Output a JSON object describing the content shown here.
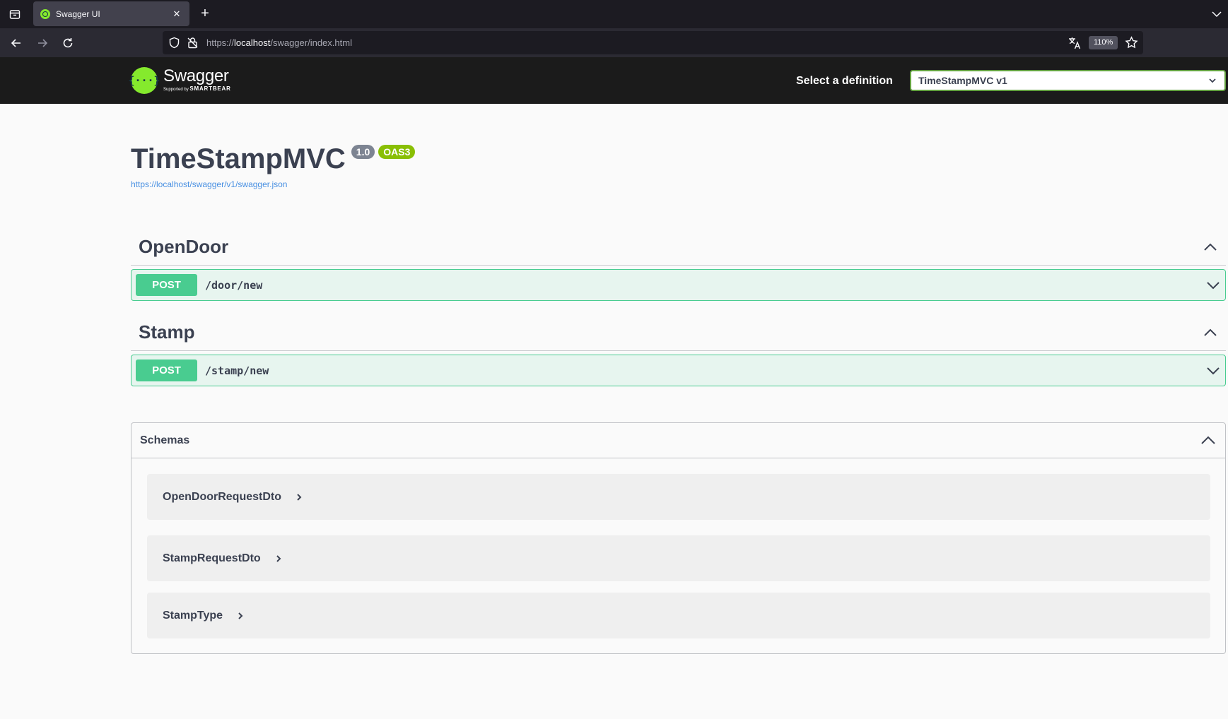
{
  "browser": {
    "tab_title": "Swagger UI",
    "url_prefix": "https://",
    "url_host": "localhost",
    "url_path": "/swagger/index.html",
    "zoom": "110%"
  },
  "swagger": {
    "logo_name": "Swagger",
    "logo_sub_prefix": "Supported by",
    "logo_sub_brand": "SMARTBEAR",
    "definition_label": "Select a definition",
    "definition_value": "TimeStampMVC v1"
  },
  "info": {
    "title": "TimeStampMVC",
    "version": "1.0",
    "oas": "OAS3",
    "spec_url": "https://localhost/swagger/v1/swagger.json"
  },
  "tags": [
    {
      "name": "OpenDoor",
      "operations": [
        {
          "method": "POST",
          "path": "/door/new"
        }
      ]
    },
    {
      "name": "Stamp",
      "operations": [
        {
          "method": "POST",
          "path": "/stamp/new"
        }
      ]
    }
  ],
  "schemas": {
    "title": "Schemas",
    "models": [
      "OpenDoorRequestDto",
      "StampRequestDto",
      "StampType"
    ]
  },
  "colors": {
    "post": "#49cc90",
    "accent": "#85ea2d",
    "text": "#3b4151",
    "link": "#4990e2"
  }
}
